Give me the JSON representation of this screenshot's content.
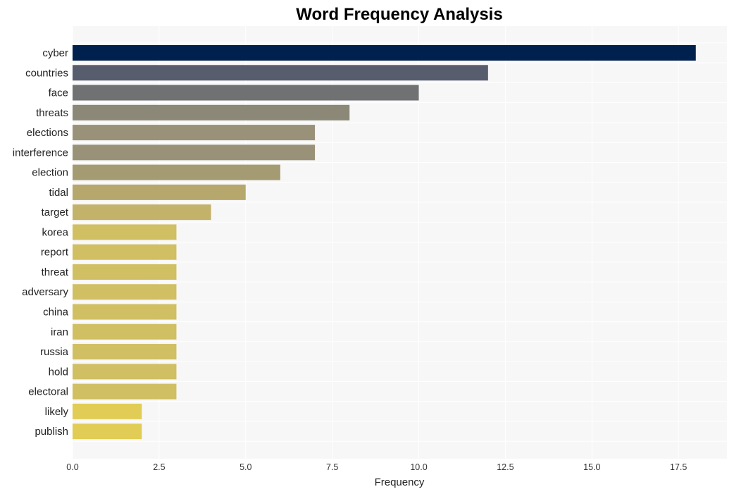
{
  "chart_data": {
    "type": "bar",
    "orientation": "horizontal",
    "title": "Word Frequency Analysis",
    "xlabel": "Frequency",
    "ylabel": "",
    "xlim": [
      0,
      18.9
    ],
    "xticks": [
      0.0,
      2.5,
      5.0,
      7.5,
      10.0,
      12.5,
      15.0,
      17.5
    ],
    "xtick_labels": [
      "0.0",
      "2.5",
      "5.0",
      "7.5",
      "10.0",
      "12.5",
      "15.0",
      "17.5"
    ],
    "grid": true,
    "categories": [
      "cyber",
      "countries",
      "face",
      "threats",
      "elections",
      "interference",
      "election",
      "tidal",
      "target",
      "korea",
      "report",
      "threat",
      "adversary",
      "china",
      "iran",
      "russia",
      "hold",
      "electoral",
      "likely",
      "publish"
    ],
    "values": [
      18,
      12,
      10,
      8,
      7,
      7,
      6,
      5,
      4,
      3,
      3,
      3,
      3,
      3,
      3,
      3,
      3,
      3,
      2,
      2
    ],
    "colors": [
      "#00204e",
      "#575d6d",
      "#707173",
      "#8b8878",
      "#999279",
      "#999279",
      "#a59b73",
      "#b6a76c",
      "#c3b26a",
      "#d0bf63",
      "#d0bf63",
      "#d0bf63",
      "#d0bf63",
      "#d0bf63",
      "#d0bf63",
      "#d0bf63",
      "#d0bf63",
      "#d0bf63",
      "#e1cc55",
      "#e1cc55"
    ],
    "plot_background": "#f7f7f7",
    "grid_color": "#ffffff"
  }
}
